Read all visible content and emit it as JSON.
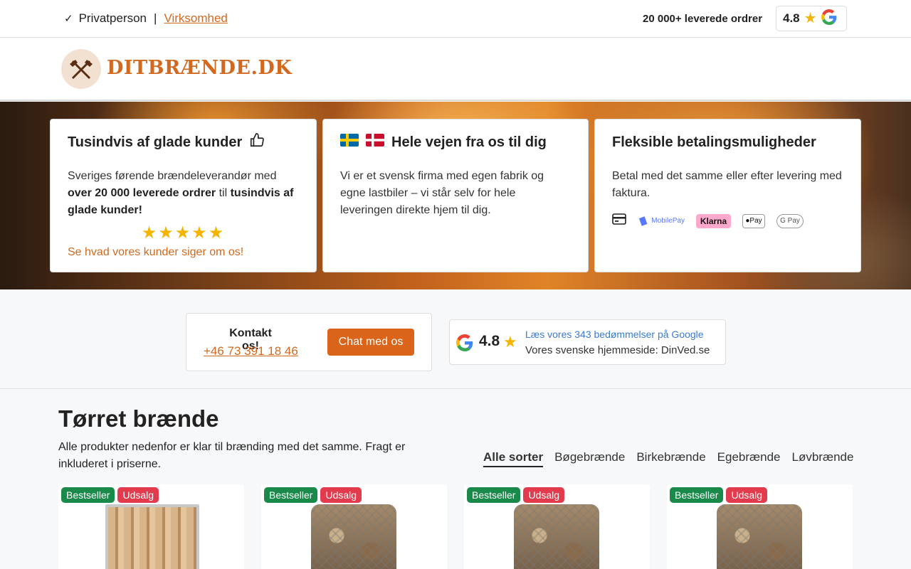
{
  "topbar": {
    "check": "✓",
    "private": "Privatperson",
    "separator": "|",
    "business": "Virksomhed",
    "orders": "20 000+ leverede ordrer",
    "rating": "4.8"
  },
  "header": {
    "logo_text": "DITBRÆNDE.DK"
  },
  "hero": {
    "card1": {
      "title": "Tusindvis af glade kunder",
      "text_a": "Sveriges førende brændeleverandør med ",
      "text_b": "over 20 000 leverede ordrer",
      "text_c": " til ",
      "text_d": "tusindvis af glade kunder!",
      "stars": "★★★★★",
      "link": "Se hvad vores kunder siger om os!"
    },
    "card2": {
      "title": "Hele vejen fra os til dig",
      "text": "Vi er et svensk firma med egen fabrik og egne lastbiler – vi står selv for hele leveringen direkte hjem til dig."
    },
    "card3": {
      "title": "Fleksible betalingsmuligheder",
      "text": "Betal med det samme eller efter levering med faktura.",
      "payments": {
        "mobilepay": "MobilePay",
        "klarna": "Klarna",
        "applepay": "Pay",
        "googlepay": "G Pay"
      }
    }
  },
  "contact": {
    "title": "Kontakt os!",
    "phone": "+46 73 391 18 46",
    "chat_button": "Chat med os"
  },
  "google": {
    "rating": "4.8",
    "reviews_link": "Læs vores 343 bedømmelser på Google",
    "homepage": "Vores svenske hjemmeside: DinVed.se"
  },
  "products": {
    "title": "Tørret brænde",
    "description": "Alle produkter nedenfor er klar til brænding med det samme. Fragt er inkluderet i priserne.",
    "filters": [
      "Alle sorter",
      "Bøgebrænde",
      "Birkebrænde",
      "Egebrænde",
      "Løvbrænde"
    ],
    "badges": {
      "bestseller": "Bestseller",
      "sale": "Udsalg"
    }
  },
  "colors": {
    "accent": "#d2691e",
    "button": "#d9641a",
    "badge_green": "#1a8a4a",
    "badge_red": "#e23b4d",
    "star": "#f4b400",
    "link_blue": "#3a7bd5"
  }
}
